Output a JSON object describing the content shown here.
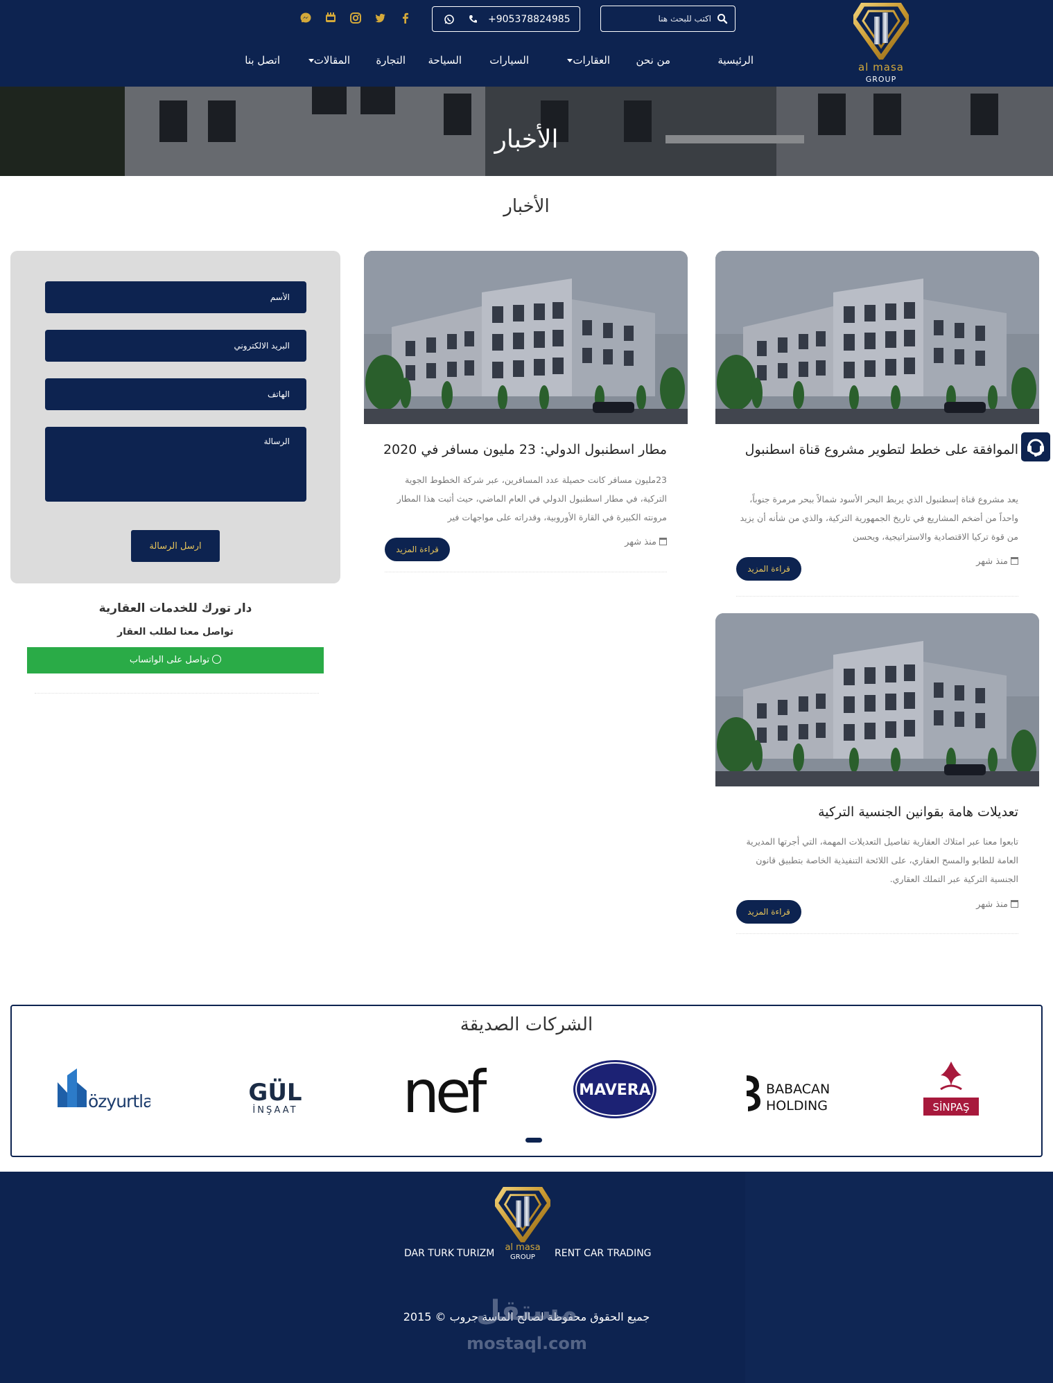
{
  "header": {
    "logo": {
      "brand": "al masa",
      "group": "GROUP"
    },
    "search_placeholder": "اكتب للبحث هنا",
    "phone": "+905378824985",
    "social": [
      "facebook-icon",
      "twitter-icon",
      "instagram-icon",
      "youtube-icon",
      "messenger-icon"
    ],
    "nav": [
      {
        "label": "الرئيسية",
        "dropdown": false
      },
      {
        "label": "من نحن",
        "dropdown": false
      },
      {
        "label": "العقارات",
        "dropdown": true
      },
      {
        "label": "السيارات",
        "dropdown": false
      },
      {
        "label": "السياحة",
        "dropdown": false
      },
      {
        "label": "التجارة",
        "dropdown": false
      },
      {
        "label": "المقالات",
        "dropdown": true
      },
      {
        "label": "اتصل بنا",
        "dropdown": false
      }
    ]
  },
  "hero": {
    "title": "الأخبار"
  },
  "page_heading": "الأخبار",
  "articles": [
    {
      "title": "الموافقة على خطط لتطوير مشروع قناة اسطنبول",
      "excerpt": "يعد مشروع قناة إسطنبول الذي يربط البحر الأسود شمالاً ببحر مرمرة جنوباً، واحداً من أضخم المشاريع في تاريخ الجمهورية التركية، والذي من شأنه أن يزيد من قوة تركيا الاقتصادية والاستراتيجية، ويحسن",
      "date": "منذ شهر",
      "more": "قراءة المزيد"
    },
    {
      "title": "مطار اسطنبول الدولي: 23 مليون مسافر في 2020",
      "excerpt": "23مليون مسافر كانت حصيلة عدد المسافرين، عبر شركة الخطوط الجوية التركية، في مطار اسطنبول الدولي في العام الماضي، حيث أثبت هذا المطار مرونته الكبيرة في القارة الأوروبية، وقدراته على مواجهات فير",
      "date": "منذ شهر",
      "more": "قراءة المزيد"
    },
    {
      "title": "تعديلات هامة بقوانين الجنسية التركية",
      "excerpt": "تابعوا معنا عبر امتلاك العقارية تفاصيل التعديلات المهمة، التي أجرتها المديرية العامة للطابو والمسح العقاري، على اللائحة التنفيذية الخاصة بتطبيق قانون الجنسية التركية عبر التملك العقاري.",
      "date": "منذ شهر",
      "more": "قراءة المزيد"
    }
  ],
  "contact_form": {
    "name_placeholder": "الأسم",
    "email_placeholder": "البريد الالكتروني",
    "phone_placeholder": "الهاتف",
    "message_placeholder": "الرسالة",
    "send_label": "ارسل الرسالة"
  },
  "sidebar": {
    "office_title": "دار تورك للخدمات العقارية",
    "office_subtitle": "تواصل معنا لطلب العقار",
    "whatsapp_label": "تواصل على الواتساب"
  },
  "partners": {
    "title": "الشركات الصديقة",
    "logos": [
      {
        "name": "SİNPAŞ"
      },
      {
        "name": "BABACAN",
        "sub": "HOLDING"
      },
      {
        "name": "MAVERA"
      },
      {
        "name": "nef"
      },
      {
        "name": "GÜL",
        "sub": "İNŞAAT"
      },
      {
        "name": "özyurtlar"
      }
    ]
  },
  "footer": {
    "links": [
      "DAR TURK",
      "TURIZM",
      "RENT CAR",
      "TRADING"
    ],
    "logo": {
      "brand": "al masa",
      "group": "GROUP"
    },
    "copyright": "جميع الحقوق محفوظة لصالح الماسة جروب © 2015",
    "watermark_ar": "مستقل",
    "watermark_en": "mostaql.com"
  },
  "colors": {
    "navy": "#0d2350",
    "gold": "#d4a93a",
    "green": "#2aab47"
  }
}
